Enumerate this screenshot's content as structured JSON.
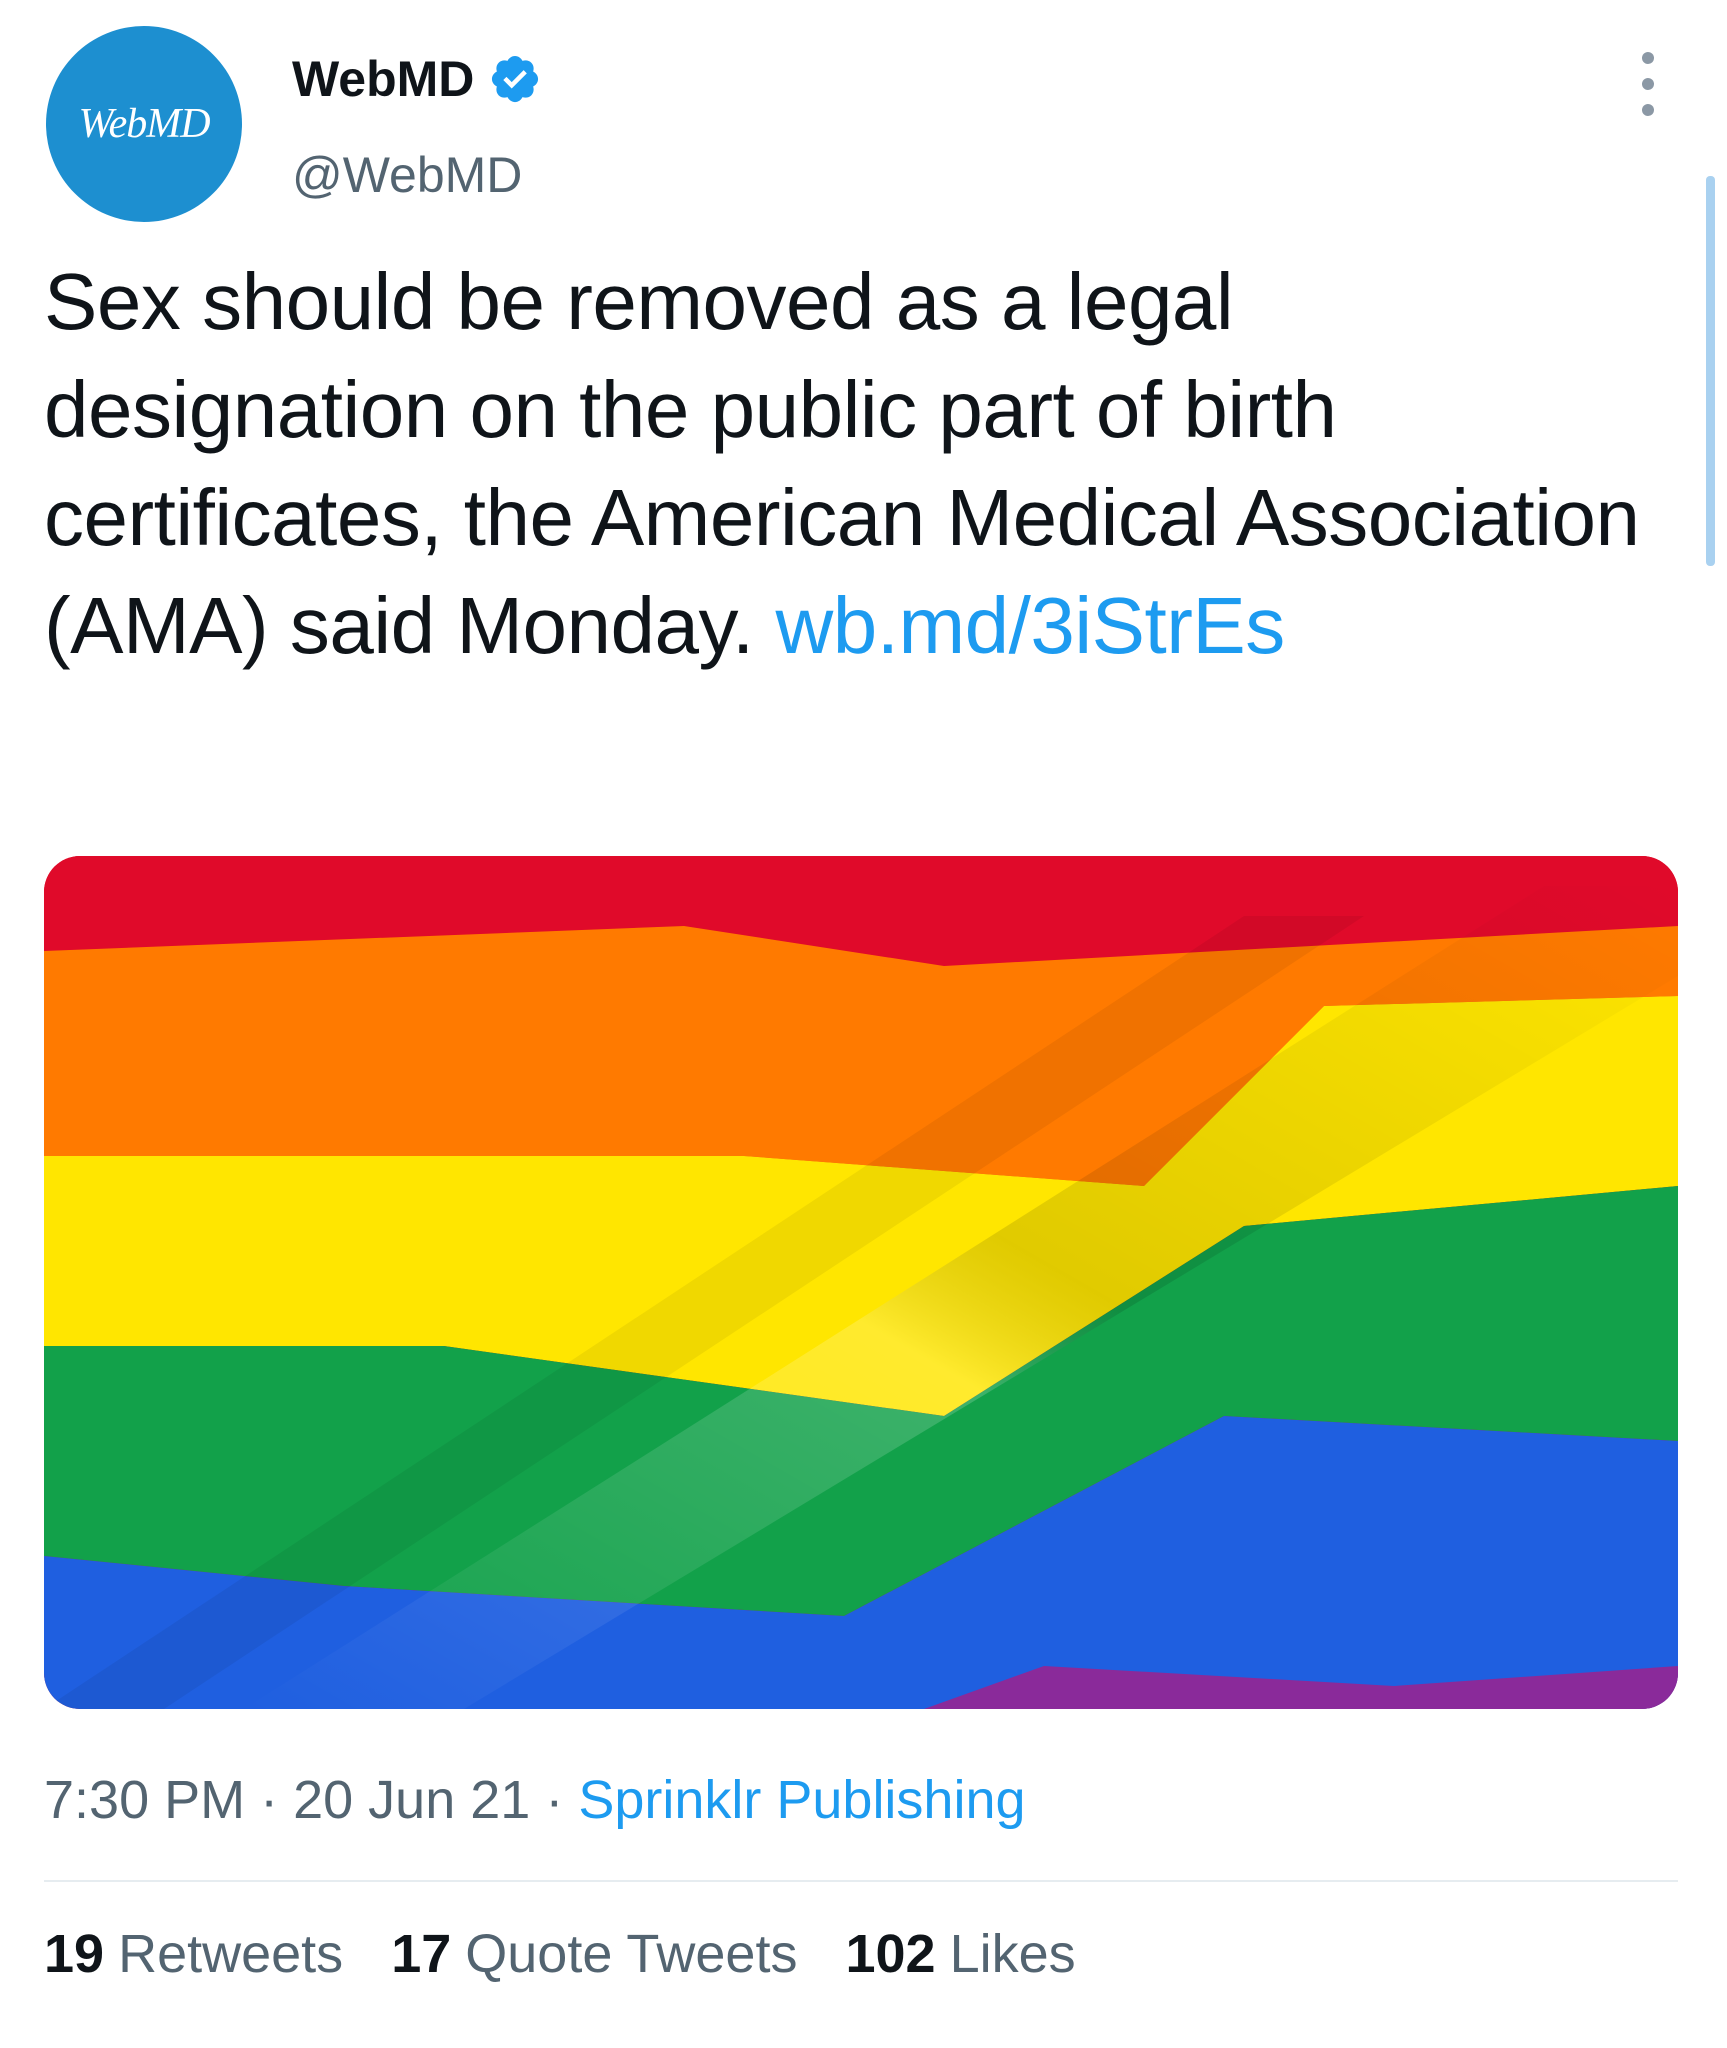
{
  "author": {
    "avatar_text": "WebMD",
    "display_name": "WebMD",
    "handle": "@WebMD",
    "verified": true,
    "avatar_color": "#1d8fd0"
  },
  "tweet": {
    "text": "Sex should be removed as a legal designation on the public part of birth certificates, the American Medical Association (AMA) said Monday. ",
    "link_text": "wb.md/3iStrEs",
    "link_color": "#1d9bf0"
  },
  "media": {
    "description_icon": "rainbow-flag-image",
    "colors": [
      "#e40521",
      "#ff7a00",
      "#ffe600",
      "#12a14a",
      "#1f5fe0",
      "#8a2a9a"
    ]
  },
  "meta": {
    "time": "7:30 PM",
    "separator": " · ",
    "date": "20 Jun 21",
    "source": "Sprinklr Publishing"
  },
  "stats": {
    "retweets_count": "19",
    "retweets_label": "Retweets",
    "quotes_count": "17",
    "quotes_label": "Quote Tweets",
    "likes_count": "102",
    "likes_label": "Likes"
  },
  "icons": {
    "more": "more-vertical-icon",
    "verified": "verified-badge-icon"
  }
}
